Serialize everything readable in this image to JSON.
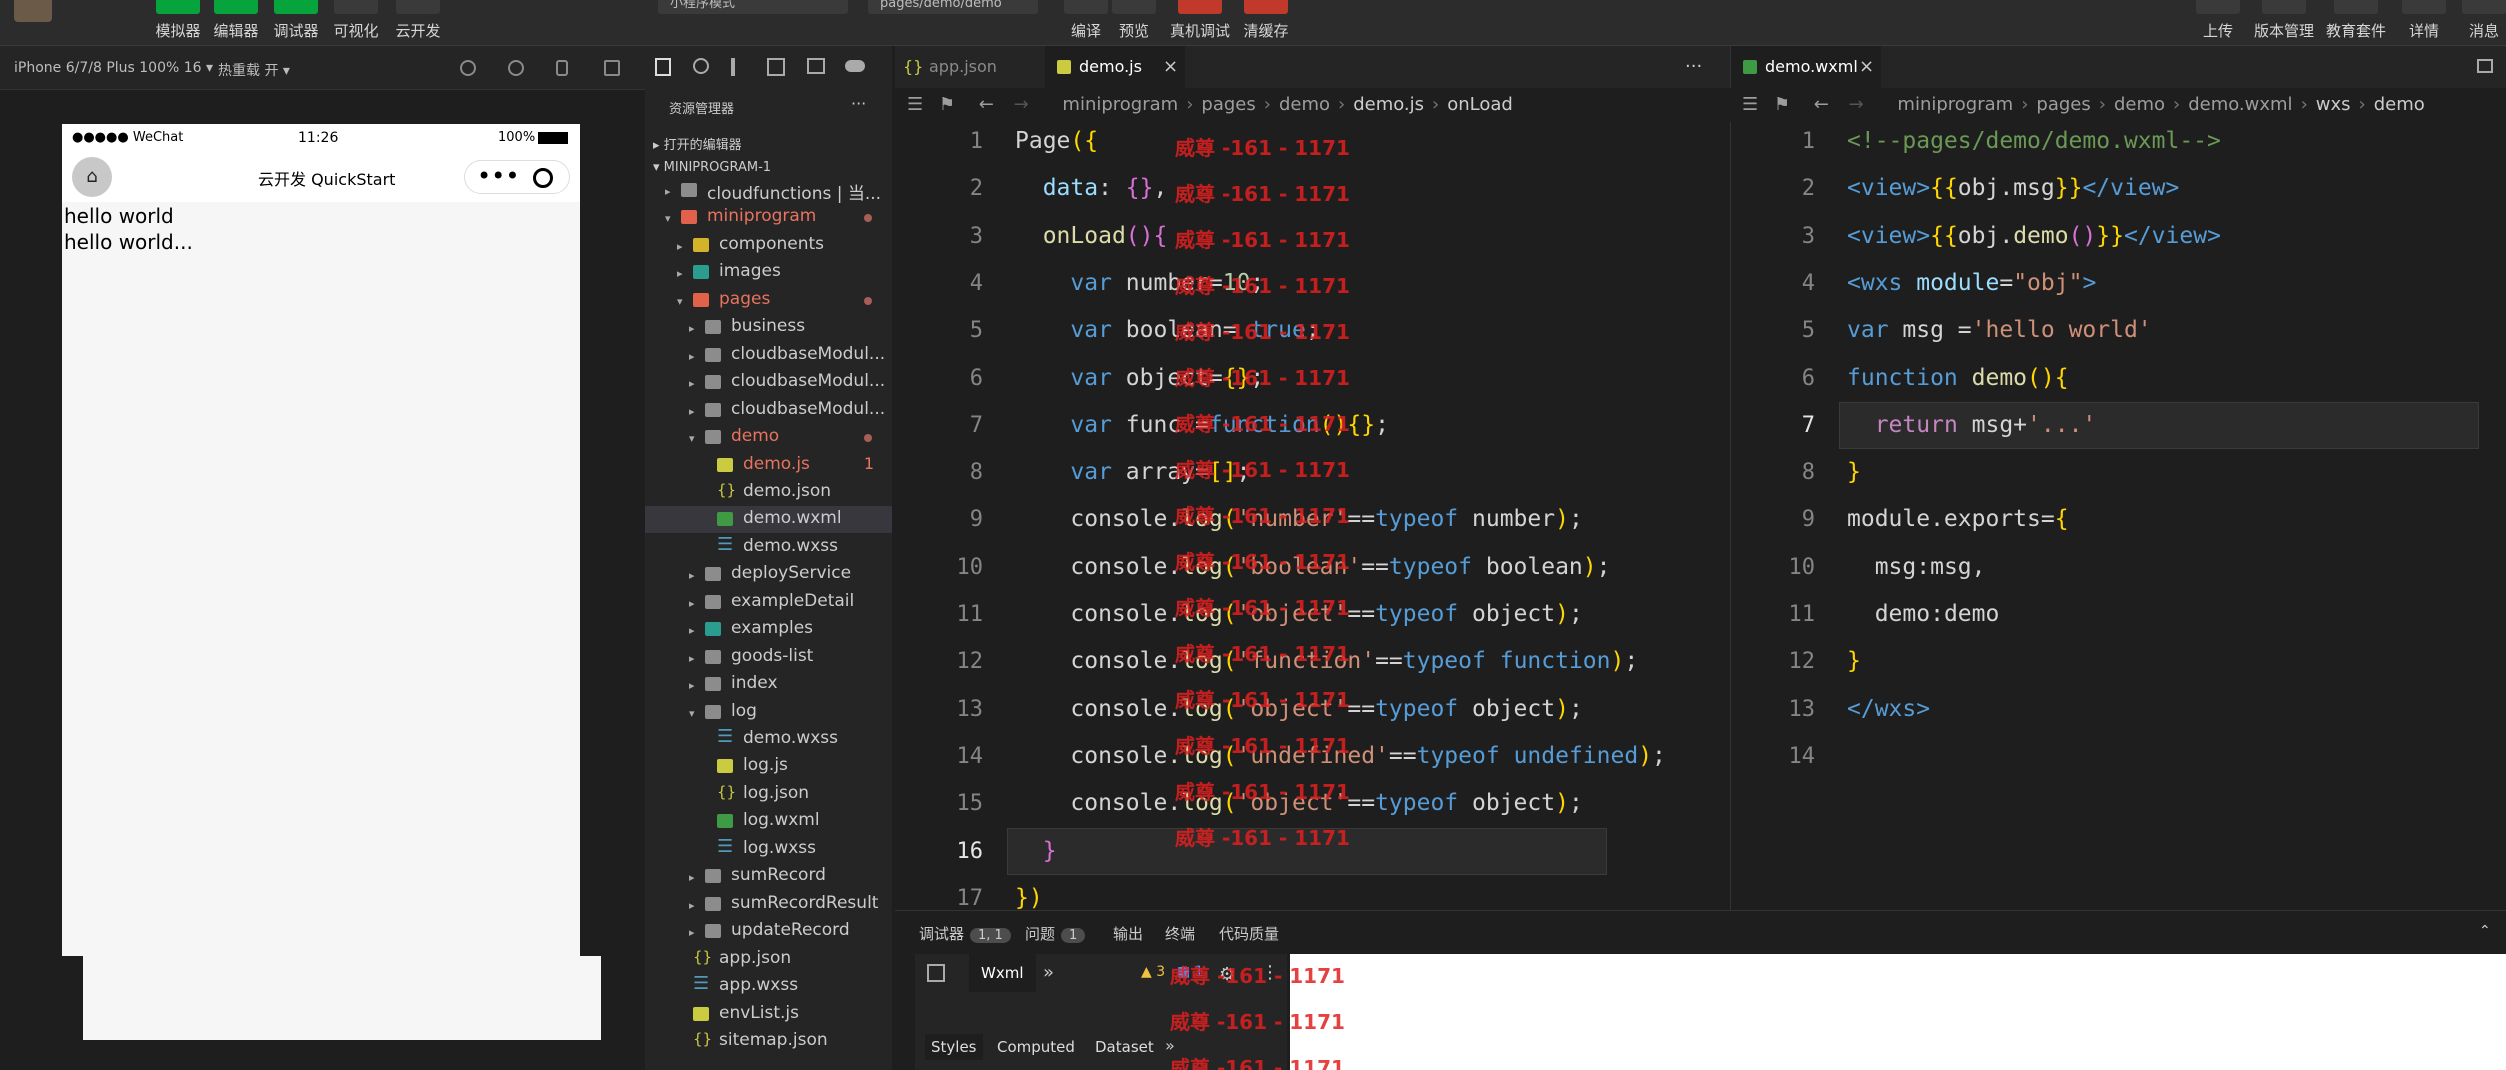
{
  "toolbar": {
    "buttons": [
      {
        "label": "模拟器"
      },
      {
        "label": "编辑器"
      },
      {
        "label": "调试器"
      },
      {
        "label": "可视化"
      },
      {
        "label": "云开发"
      }
    ],
    "mode_select": "小程序模式",
    "page_select": "pages/demo/demo",
    "center_buttons": [
      {
        "label": "编译"
      },
      {
        "label": "预览"
      },
      {
        "label": "真机调试"
      },
      {
        "label": "清缓存"
      }
    ],
    "right_buttons": [
      {
        "label": "上传"
      },
      {
        "label": "版本管理"
      },
      {
        "label": "教育套件"
      },
      {
        "label": "详情"
      },
      {
        "label": "消息"
      }
    ]
  },
  "simulator": {
    "device": "iPhone 6/7/8 Plus 100% 16 ▾",
    "hot_reload": "热重载 开 ▾",
    "status_carrier": "●●●●● WeChat",
    "status_time": "11:26",
    "status_battery": "100%",
    "nav_title": "云开发 QuickStart",
    "capsule_dots": "•••",
    "content": [
      "hello world",
      "hello world..."
    ]
  },
  "explorer": {
    "title": "资源管理器",
    "more": "···",
    "open_editors": "打开的编辑器",
    "project": "MINIPROGRAM-1",
    "tree": [
      {
        "name": "cloudfunctions | 当...",
        "indent": 1,
        "icon": "fold",
        "chev": "▸"
      },
      {
        "name": "miniprogram",
        "indent": 1,
        "icon": "fold red",
        "chev": "▾",
        "color": "#e8735f",
        "dot": true
      },
      {
        "name": "components",
        "indent": 2,
        "icon": "fold yellow",
        "chev": "▸"
      },
      {
        "name": "images",
        "indent": 2,
        "icon": "fold teal",
        "chev": "▸"
      },
      {
        "name": "pages",
        "indent": 2,
        "icon": "fold red",
        "chev": "▾",
        "color": "#e8735f",
        "dot": true
      },
      {
        "name": "business",
        "indent": 3,
        "icon": "fold",
        "chev": "▸"
      },
      {
        "name": "cloudbaseModul...",
        "indent": 3,
        "icon": "fold",
        "chev": "▸"
      },
      {
        "name": "cloudbaseModul...",
        "indent": 3,
        "icon": "fold",
        "chev": "▸"
      },
      {
        "name": "cloudbaseModul...",
        "indent": 3,
        "icon": "fold",
        "chev": "▸"
      },
      {
        "name": "demo",
        "indent": 3,
        "icon": "fold",
        "chev": "▾",
        "color": "#e8735f",
        "dot": true
      },
      {
        "name": "demo.js",
        "indent": 4,
        "icon": "js",
        "color": "#e8735f",
        "count": "1"
      },
      {
        "name": "demo.json",
        "indent": 4,
        "icon": "json"
      },
      {
        "name": "demo.wxml",
        "indent": 4,
        "icon": "wxml",
        "selected": true
      },
      {
        "name": "demo.wxss",
        "indent": 4,
        "icon": "wxss"
      },
      {
        "name": "deployService",
        "indent": 3,
        "icon": "fold",
        "chev": "▸"
      },
      {
        "name": "exampleDetail",
        "indent": 3,
        "icon": "fold",
        "chev": "▸"
      },
      {
        "name": "examples",
        "indent": 3,
        "icon": "fold teal",
        "chev": "▸"
      },
      {
        "name": "goods-list",
        "indent": 3,
        "icon": "fold",
        "chev": "▸"
      },
      {
        "name": "index",
        "indent": 3,
        "icon": "fold",
        "chev": "▸"
      },
      {
        "name": "log",
        "indent": 3,
        "icon": "fold",
        "chev": "▾"
      },
      {
        "name": "demo.wxss",
        "indent": 4,
        "icon": "wxss"
      },
      {
        "name": "log.js",
        "indent": 4,
        "icon": "js"
      },
      {
        "name": "log.json",
        "indent": 4,
        "icon": "json"
      },
      {
        "name": "log.wxml",
        "indent": 4,
        "icon": "wxml"
      },
      {
        "name": "log.wxss",
        "indent": 4,
        "icon": "wxss"
      },
      {
        "name": "sumRecord",
        "indent": 3,
        "icon": "fold",
        "chev": "▸"
      },
      {
        "name": "sumRecordResult",
        "indent": 3,
        "icon": "fold",
        "chev": "▸"
      },
      {
        "name": "updateRecord",
        "indent": 3,
        "icon": "fold",
        "chev": "▸"
      },
      {
        "name": "app.json",
        "indent": 2,
        "icon": "json"
      },
      {
        "name": "app.wxss",
        "indent": 2,
        "icon": "wxss"
      },
      {
        "name": "envList.js",
        "indent": 2,
        "icon": "js"
      },
      {
        "name": "sitemap.json",
        "indent": 2,
        "icon": "json"
      }
    ]
  },
  "editor_left": {
    "tabs": [
      {
        "label": "app.json",
        "active": false
      },
      {
        "label": "demo.js",
        "active": true
      }
    ],
    "close": "×",
    "more": "···",
    "breadcrumb": [
      "miniprogram",
      "pages",
      "demo",
      "demo.js",
      "onLoad"
    ],
    "lines": [
      {
        "n": "1",
        "html": "<span class='tx'>Page</span><span class='pn'>({</span>"
      },
      {
        "n": "2",
        "html": "  <span class='at'>data</span><span class='tx'>: </span><span class='pu'>{}</span><span class='tx'>,</span>"
      },
      {
        "n": "3",
        "html": "  <span class='fn'>onLoad</span><span class='pu'>()</span><span class='pu'>{</span>"
      },
      {
        "n": "4",
        "html": "    <span class='bl'>var</span><span class='tx'> number=</span><span class='num'>10</span><span class='tx'>;</span>"
      },
      {
        "n": "5",
        "html": "    <span class='bl'>var</span><span class='tx'> boolean= </span><span class='bl'>true</span><span class='tx'>;</span>"
      },
      {
        "n": "6",
        "html": "    <span class='bl'>var</span><span class='tx'> object=</span><span class='pn'>{}</span><span class='tx'>;</span>"
      },
      {
        "n": "7",
        "html": "    <span class='bl'>var</span><span class='tx'> func =</span><span class='bl'>function</span><span class='pn'>()</span><span class='pn'>{}</span><span class='tx'>;</span>"
      },
      {
        "n": "8",
        "html": "    <span class='bl'>var</span><span class='tx'> array=</span><span class='pn'>[]</span><span class='tx'>;</span>"
      },
      {
        "n": "9",
        "html": "    <span class='tx'>console.</span><span class='fn'>log</span><span class='pn'>(</span><span class='str'>'number'</span><span class='tx'>==</span><span class='bl'>typeof</span><span class='tx'> number</span><span class='pn'>)</span><span class='tx'>;</span>"
      },
      {
        "n": "10",
        "html": "    <span class='tx'>console.</span><span class='fn'>log</span><span class='pn'>(</span><span class='str'>'boolean'</span><span class='tx'>==</span><span class='bl'>typeof</span><span class='tx'> boolean</span><span class='pn'>)</span><span class='tx'>;</span>"
      },
      {
        "n": "11",
        "html": "    <span class='tx'>console.</span><span class='fn'>log</span><span class='pn'>(</span><span class='str'>'object'</span><span class='tx'>==</span><span class='bl'>typeof</span><span class='tx'> object</span><span class='pn'>)</span><span class='tx'>;</span>"
      },
      {
        "n": "12",
        "html": "    <span class='tx'>console.</span><span class='fn'>log</span><span class='pn'>(</span><span class='str'>'function'</span><span class='tx'>==</span><span class='bl'>typeof</span><span class='tx'> </span><span class='bl'>function</span><span class='pn'>)</span><span class='tx'>;</span>"
      },
      {
        "n": "13",
        "html": "    <span class='tx'>console.</span><span class='fn'>log</span><span class='pn'>(</span><span class='str'>'object'</span><span class='tx'>==</span><span class='bl'>typeof</span><span class='tx'> object</span><span class='pn'>)</span><span class='tx'>;</span>"
      },
      {
        "n": "14",
        "html": "    <span class='tx'>console.</span><span class='fn'>log</span><span class='pn'>(</span><span class='str'>'undefined'</span><span class='tx'>==</span><span class='bl'>typeof</span><span class='tx'> </span><span class='bl'>undefined</span><span class='pn'>)</span><span class='tx'>;</span>"
      },
      {
        "n": "15",
        "html": "    <span class='tx'>console.</span><span class='fn'>log</span><span class='pn'>(</span><span class='str'>'object'</span><span class='tx'>==</span><span class='bl'>typeof</span><span class='tx'> object</span><span class='pn'>)</span><span class='tx'>;</span>"
      },
      {
        "n": "16",
        "html": "  <span class='pu'>}</span>",
        "current": true
      },
      {
        "n": "17",
        "html": "<span class='pn'>})</span>"
      }
    ],
    "watermark": "威尊 -161 - 1171"
  },
  "editor_right": {
    "tab": "demo.wxml",
    "close": "×",
    "breadcrumb": [
      "miniprogram",
      "pages",
      "demo",
      "demo.wxml",
      "wxs",
      "demo"
    ],
    "lines": [
      {
        "n": "1",
        "html": "<span class='cm'>&lt;!--pages/demo/demo.wxml--&gt;</span>"
      },
      {
        "n": "2",
        "html": "<span class='bl'>&lt;view&gt;</span><span class='pn'>{{</span><span class='tx'>obj.msg</span><span class='pn'>}}</span><span class='bl'>&lt;/view&gt;</span>"
      },
      {
        "n": "3",
        "html": "<span class='bl'>&lt;view&gt;</span><span class='pn'>{{</span><span class='tx'>obj.</span><span class='fn'>demo</span><span class='pu'>()</span><span class='pn'>}}</span><span class='bl'>&lt;/view&gt;</span>"
      },
      {
        "n": "4",
        "html": "<span class='bl'>&lt;wxs</span><span class='at'> module</span><span class='tx'>=</span><span class='str'>\"obj\"</span><span class='bl'>&gt;</span>"
      },
      {
        "n": "5",
        "html": "<span class='bl'>var</span><span class='tx'> msg =</span><span class='str'>'hello world'</span>"
      },
      {
        "n": "6",
        "html": "<span class='bl'>function</span><span class='tx'> </span><span class='fn'>demo</span><span class='pn'>()</span><span class='pn'>{</span>"
      },
      {
        "n": "7",
        "html": "  <span class='kw'>return</span><span class='tx'> msg+</span><span class='str'>'...'</span>",
        "current": true
      },
      {
        "n": "8",
        "html": "<span class='pn'>}</span>"
      },
      {
        "n": "9",
        "html": "<span class='tx'>module.exports=</span><span class='pn'>{</span>"
      },
      {
        "n": "10",
        "html": "  <span class='tx'>msg:msg,</span>"
      },
      {
        "n": "11",
        "html": "  <span class='tx'>demo:demo</span>"
      },
      {
        "n": "12",
        "html": "<span class='pn'>}</span>"
      },
      {
        "n": "13",
        "html": "<span class='bl'>&lt;/wxs&gt;</span>"
      },
      {
        "n": "14",
        "html": ""
      }
    ]
  },
  "panel": {
    "tabs": [
      {
        "label": "调试器",
        "badge": "1, 1"
      },
      {
        "label": "问题",
        "badge": "1"
      },
      {
        "label": "输出"
      },
      {
        "label": "终端"
      },
      {
        "label": "代码质量"
      }
    ],
    "devtools_tab": "Wxml",
    "warn_count": "3",
    "err_count": "1",
    "subtabs": [
      "Styles",
      "Computed",
      "Dataset"
    ]
  }
}
